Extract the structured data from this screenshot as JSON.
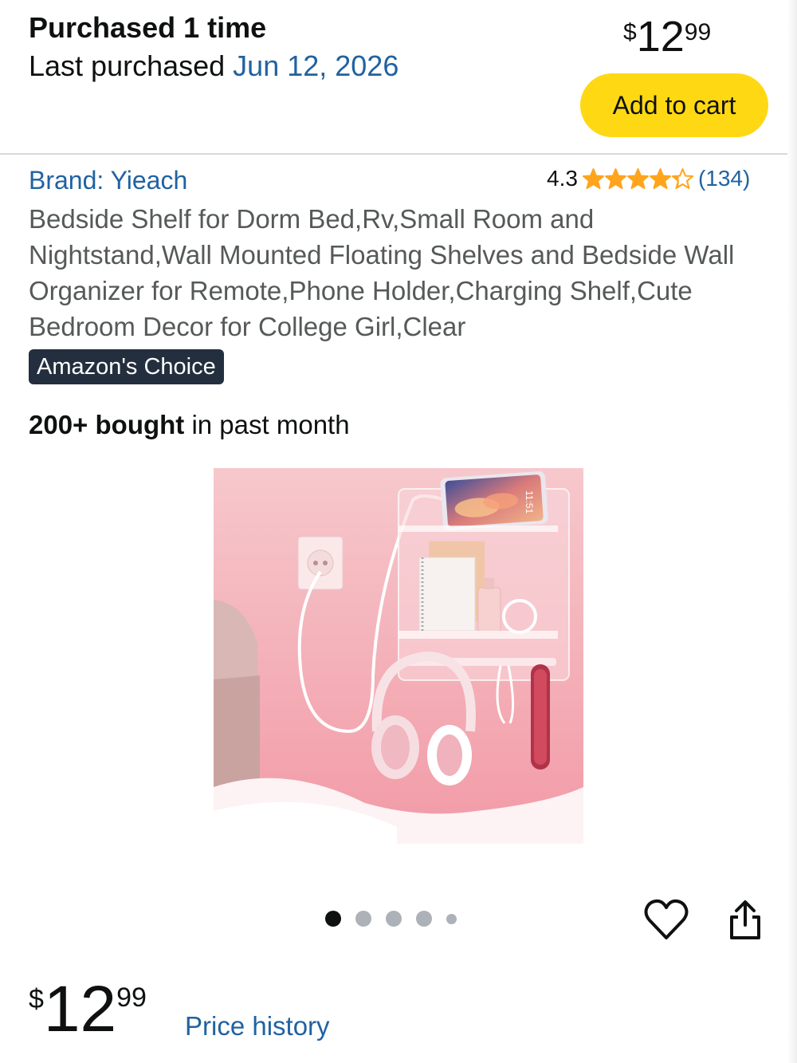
{
  "purchase": {
    "title": "Purchased 1 time",
    "last_label": "Last purchased ",
    "last_date": "Jun 12, 2026"
  },
  "top_price": {
    "currency": "$",
    "whole": "12",
    "fraction": "99"
  },
  "cart_button": "Add to cart",
  "product": {
    "brand": "Brand: Yieach",
    "rating": "4.3",
    "rating_stars": 4.3,
    "review_count": "(134)",
    "title": "Bedside Shelf for Dorm Bed,Rv,Small Room and Nightstand,Wall Mounted Floating Shelves and Bedside Wall Organizer for Remote,Phone Holder,Charging Shelf,Cute Bedroom Decor for College Girl,Clear",
    "badge": "Amazon's Choice",
    "bought_bold": "200+ bought",
    "bought_rest": " in past month",
    "phone_time": "11:51"
  },
  "gallery": {
    "total_images": 5,
    "active_index": 0
  },
  "bottom_price": {
    "currency": "$",
    "whole": "12",
    "fraction": "99"
  },
  "price_history": "Price history",
  "icons": {
    "heart": "heart-outline-icon",
    "share": "share-icon",
    "star": "star-icon",
    "star_color": "#ffa41c",
    "accent": "#ffd814",
    "link_color": "#2162a1"
  }
}
